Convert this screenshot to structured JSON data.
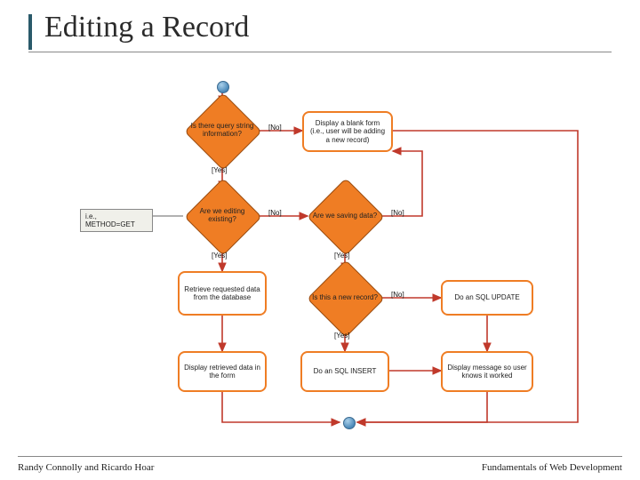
{
  "title": "Editing a Record",
  "footer": {
    "left": "Randy Connolly and Ricardo Hoar",
    "right": "Fundamentals of Web Development"
  },
  "note": "i.e., METHOD=GET",
  "diamonds": {
    "d1": "Is there query string information?",
    "d2": "Are we editing existing?",
    "d3": "Are we saving data?",
    "d4": "Is this a new record?"
  },
  "boxes": {
    "b_blank": "Display a blank form (i.e., user will be adding a new record)",
    "b_retrieve": "Retrieve requested data from the database",
    "b_display_retrieved": "Display retrieved data in the form",
    "b_insert": "Do an SQL INSERT",
    "b_update": "Do an SQL UPDATE",
    "b_display_msg": "Display message so user knows it worked"
  },
  "labels": {
    "yes": "[Yes]",
    "no": "[No]"
  },
  "chart_data": {
    "type": "flowchart",
    "title": "Editing a Record",
    "start": "start",
    "nodes": [
      {
        "id": "start",
        "type": "start"
      },
      {
        "id": "d1",
        "type": "decision",
        "text": "Is there query string information?"
      },
      {
        "id": "b_blank",
        "type": "process",
        "text": "Display a blank form (i.e., user will be adding a new record)"
      },
      {
        "id": "d2",
        "type": "decision",
        "text": "Are we editing existing?",
        "note": "i.e., METHOD=GET"
      },
      {
        "id": "d3",
        "type": "decision",
        "text": "Are we saving data?"
      },
      {
        "id": "b_retrieve",
        "type": "process",
        "text": "Retrieve requested data from the database"
      },
      {
        "id": "b_display_retrieved",
        "type": "process",
        "text": "Display retrieved data in the form"
      },
      {
        "id": "d4",
        "type": "decision",
        "text": "Is this a new record?"
      },
      {
        "id": "b_insert",
        "type": "process",
        "text": "Do an SQL INSERT"
      },
      {
        "id": "b_update",
        "type": "process",
        "text": "Do an SQL UPDATE"
      },
      {
        "id": "b_display_msg",
        "type": "process",
        "text": "Display message so user knows it worked"
      },
      {
        "id": "end",
        "type": "end"
      }
    ],
    "edges": [
      {
        "from": "start",
        "to": "d1"
      },
      {
        "from": "d1",
        "to": "b_blank",
        "label": "[No]"
      },
      {
        "from": "d1",
        "to": "d2",
        "label": "[Yes]"
      },
      {
        "from": "d2",
        "to": "d3",
        "label": "[No]"
      },
      {
        "from": "d2",
        "to": "b_retrieve",
        "label": "[Yes]"
      },
      {
        "from": "b_retrieve",
        "to": "b_display_retrieved"
      },
      {
        "from": "d3",
        "to": "b_blank",
        "label": "[No]",
        "route": "right-up"
      },
      {
        "from": "d3",
        "to": "d4",
        "label": "[Yes]"
      },
      {
        "from": "d4",
        "to": "b_insert",
        "label": "[Yes]"
      },
      {
        "from": "d4",
        "to": "b_update",
        "label": "[No]"
      },
      {
        "from": "b_insert",
        "to": "b_display_msg"
      },
      {
        "from": "b_update",
        "to": "b_display_msg"
      },
      {
        "from": "b_display_retrieved",
        "to": "end",
        "route": "down-right"
      },
      {
        "from": "b_display_msg",
        "to": "end",
        "route": "down-left"
      },
      {
        "from": "b_blank",
        "to": "end",
        "route": "far-right-down"
      }
    ]
  }
}
